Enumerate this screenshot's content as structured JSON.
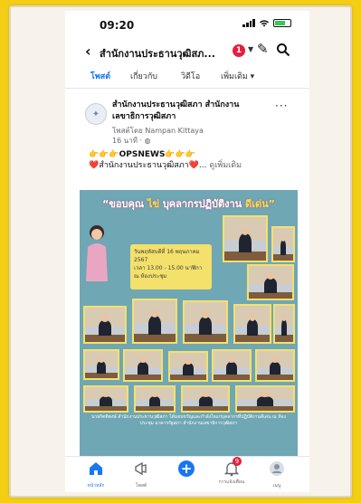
{
  "status_bar": {
    "time": "09:20"
  },
  "header": {
    "back_glyph": "‹",
    "title": "สำนักงานประธานวุฒิสภ...",
    "notification_count": "1"
  },
  "tabs": [
    {
      "label": "โพสต์",
      "active": true
    },
    {
      "label": "เกี่ยวกับ",
      "active": false
    },
    {
      "label": "วิดีโอ",
      "active": false
    },
    {
      "label": "เพิ่มเติม ▾",
      "active": false
    }
  ],
  "post": {
    "page_name": "สำนักงานประธานวุฒิสภา สำนักงานเลขาธิการวุฒิสภา",
    "byline": "โพสต์โดย Nampan Kittaya",
    "time": "16 นาที · ",
    "line1": "👉👉👉OPSNEWS👉👉👉",
    "line2": "❤️สำนักงานประธานวุฒิสภา❤️...",
    "see_more": "ดูเพิ่มเติม",
    "image": {
      "banner_text": "“ขอบคุณ",
      "banner_yellow": "ไข่",
      "banner_rest": "บุคลากรปฏิบัติงาน",
      "banner_end": "ดีเด่น”",
      "info_line1": "วันพฤหัสบดีที่ 16 พฤษภาคม 2567",
      "info_line2": "เวลา 13.00 - 15.00 นาฬิกา",
      "info_line3": "ณ ห้องประชุม",
      "caption": "นายกิตติพงษ์ สำนักงานประธานวุฒิสภา ได้มอบขวัญและกำลังใจแก่บุคลากรที่ปฏิบัติงานดีเด่น ณ ห้องประชุม อาคารรัฐสภา สำนักงานเลขาธิการวุฒิสภา"
    }
  },
  "bottom_nav": [
    {
      "label": "หน้าหลัก",
      "icon": "home-icon",
      "active": true
    },
    {
      "label": "โพสต์",
      "icon": "megaphone-icon",
      "active": false
    },
    {
      "label": "",
      "icon": "plus-icon",
      "active": false
    },
    {
      "label": "การแจ้งเตือน",
      "icon": "bell-icon",
      "badge": "9",
      "active": false
    },
    {
      "label": "เมนู",
      "icon": "menu-avatar-icon",
      "active": false
    }
  ],
  "colors": {
    "accent": "#1877f2",
    "badge": "#e41e3f",
    "background": "#f4ce14"
  }
}
